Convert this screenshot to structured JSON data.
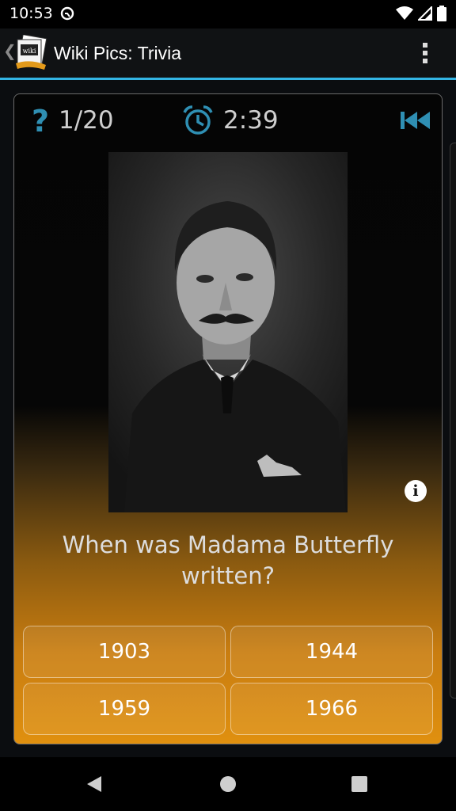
{
  "status": {
    "time": "10:53"
  },
  "app": {
    "title": "Wiki Pics: Trivia",
    "back_glyph": "❮",
    "logo_text": "wiki"
  },
  "quiz": {
    "progress": "1/20",
    "timer": "2:39",
    "help_glyph": "?",
    "info_glyph": "i",
    "question": "When was Madama Butterfly written?",
    "answers": [
      "1903",
      "1944",
      "1959",
      "1966"
    ]
  },
  "colors": {
    "accent": "#33b5e5",
    "icon_blue": "#2f8fb3",
    "gradient_bottom": "#e0900f"
  },
  "icons": {
    "question": "question-mark-icon",
    "alarm": "alarm-clock-icon",
    "rewind": "skip-back-icon",
    "info": "info-icon",
    "nav_back": "triangle-back-icon",
    "nav_home": "circle-home-icon",
    "nav_recents": "square-recents-icon"
  }
}
